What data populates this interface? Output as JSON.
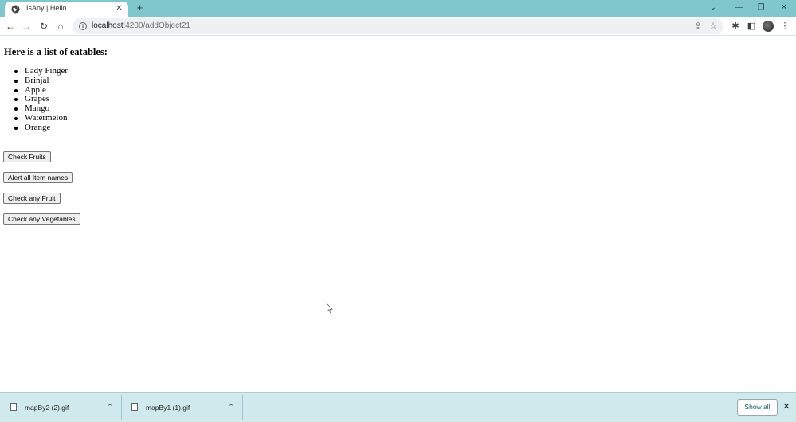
{
  "browser": {
    "tab": {
      "title": "IsAny | Hello",
      "close_glyph": "✕"
    },
    "new_tab_glyph": "+",
    "window_controls": {
      "dropdown": "⌄",
      "minimize": "—",
      "restore": "❐",
      "close": "✕"
    },
    "nav": {
      "back": "←",
      "forward": "→",
      "reload": "↻",
      "home": "⌂"
    },
    "address": {
      "host": "localhost",
      "path": ":4200/addObject21"
    },
    "info_glyph": "i",
    "omnibox_icons": {
      "share": "⇪",
      "bookmark": "☆"
    },
    "toolbar_icons": {
      "extensions": "✱",
      "side_panel": "◧",
      "menu": "⋮"
    }
  },
  "page": {
    "title": "Here is a list of eatables:",
    "items": [
      "Lady Finger",
      "Brinjal",
      "Apple",
      "Grapes",
      "Mango",
      "Watermelon",
      "Orange"
    ],
    "buttons": {
      "check_fruits": "Check Fruits",
      "alert_all": "Alert all Item names",
      "check_any_fruit": "Check any Fruit",
      "check_any_vegetables": "Check any Vegetables"
    }
  },
  "downloads": {
    "items": [
      {
        "name": "mapBy2 (2).gif"
      },
      {
        "name": "mapBy1 (1).gif"
      }
    ],
    "chevron_glyph": "⌃",
    "show_all_label": "Show all",
    "close_glyph": "✕"
  }
}
